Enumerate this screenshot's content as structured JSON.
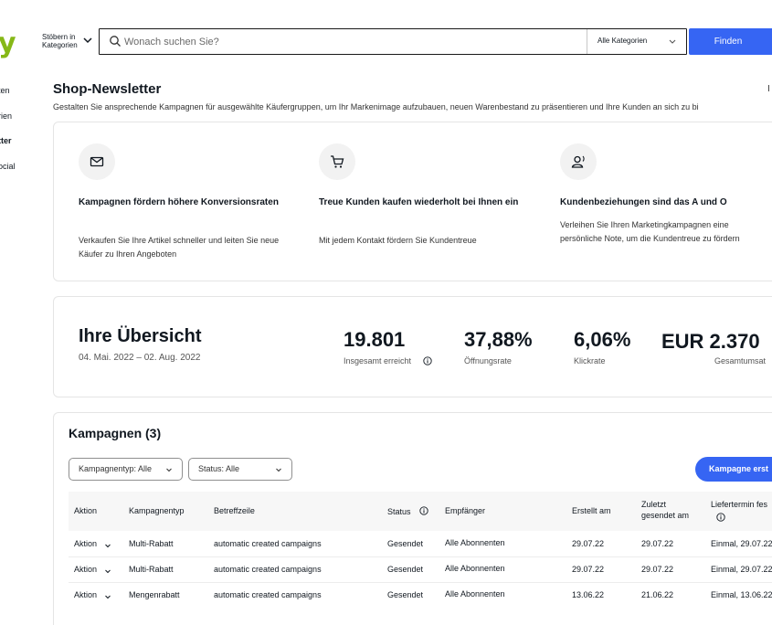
{
  "header": {
    "logo_text": "y",
    "browse_label_1": "Stöbern in",
    "browse_label_2": "Kategorien",
    "search_placeholder": "Wonach suchen Sie?",
    "category_select": "Alle Kategorien",
    "find_button": "Finden"
  },
  "sidebar": {
    "items": [
      {
        "label": "ten"
      },
      {
        "label": "rien"
      },
      {
        "label": "tter"
      },
      {
        "label": "ocial"
      }
    ]
  },
  "page": {
    "title": "Shop-Newsletter",
    "subtitle": "Gestalten Sie ansprechende Kampagnen für ausgewählte Käufergruppen, um Ihr Markenimage aufzubauen, neuen Warenbestand zu präsentieren und Ihre Kunden an sich zu bi",
    "top_right_mark": "I"
  },
  "features": [
    {
      "icon": "mail-icon",
      "title": "Kampagnen fördern höhere Konversionsraten",
      "text": "Verkaufen Sie Ihre Artikel schneller und leiten Sie neue Käufer zu Ihren Angeboten"
    },
    {
      "icon": "cart-icon",
      "title": "Treue Kunden kaufen wiederholt bei Ihnen ein",
      "text": "Mit jedem Kontakt fördern Sie Kundentreue"
    },
    {
      "icon": "customer-icon",
      "title": "Kundenbeziehungen sind das A und O",
      "text": "Verleihen Sie Ihren Marketingkampagnen eine persönliche Note, um die Kundentreue zu fördern"
    }
  ],
  "overview": {
    "title": "Ihre Übersicht",
    "date_range": "04. Mai. 2022 – 02. Aug. 2022",
    "metrics": [
      {
        "value": "19.801",
        "label": "Insgesamt erreicht"
      },
      {
        "value": "37,88%",
        "label": "Öffnungsrate"
      },
      {
        "value": "6,06%",
        "label": "Klickrate"
      },
      {
        "value": "EUR 2.370",
        "label": "Gesamtumsat"
      }
    ]
  },
  "campaigns": {
    "title": "Kampagnen (3)",
    "filter_type": "Kampagnentyp: Alle",
    "filter_status": "Status: Alle",
    "create_button": "Kampagne erst",
    "columns": {
      "action": "Aktion",
      "type": "Kampagnentyp",
      "subject": "Betreffzeile",
      "status": "Status",
      "recipients": "Empfänger",
      "created": "Erstellt am",
      "last_sent_1": "Zuletzt",
      "last_sent_2": "gesendet am",
      "delivery": "Liefertermin fes"
    },
    "rows": [
      {
        "action": "Aktion",
        "type": "Multi-Rabatt",
        "subject": "automatic created campaigns",
        "status": "Gesendet",
        "recipients": "Alle Abonnenten",
        "created": "29.07.22",
        "last_sent": "29.07.22",
        "delivery": "Einmal, 29.07.22"
      },
      {
        "action": "Aktion",
        "type": "Multi-Rabatt",
        "subject": "automatic created campaigns",
        "status": "Gesendet",
        "recipients": "Alle Abonnenten",
        "created": "29.07.22",
        "last_sent": "29.07.22",
        "delivery": "Einmal, 29.07.22"
      },
      {
        "action": "Aktion",
        "type": "Mengenrabatt",
        "subject": "automatic created campaigns",
        "status": "Gesendet",
        "recipients": "Alle Abonnenten",
        "created": "13.06.22",
        "last_sent": "21.06.22",
        "delivery": "Einmal, 13.06.22"
      }
    ]
  },
  "colors": {
    "accent": "#3665f3",
    "logo": "#86b817"
  }
}
